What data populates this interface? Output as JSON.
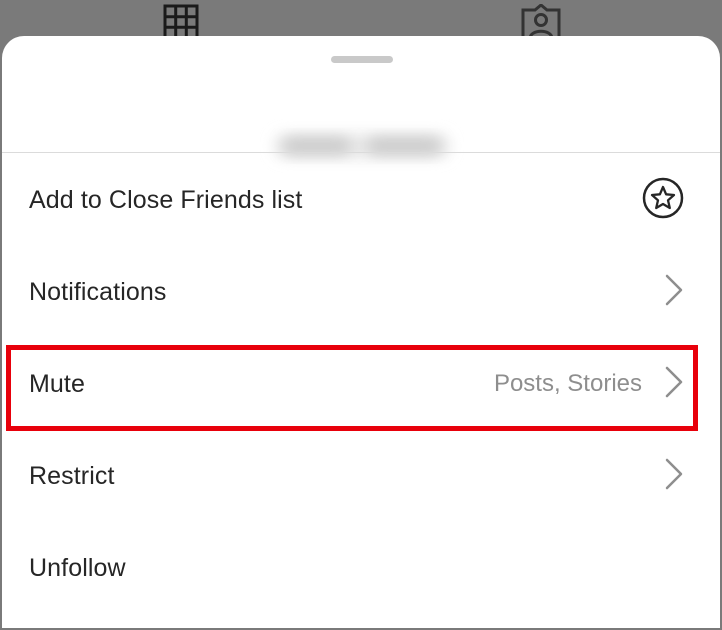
{
  "sheet": {
    "account_name_blurred": ""
  },
  "menu": {
    "items": [
      {
        "label": "Add to Close Friends list",
        "value": "",
        "icon": "star-circle-icon"
      },
      {
        "label": "Notifications",
        "value": "",
        "icon": "chevron-right-icon"
      },
      {
        "label": "Mute",
        "value": "Posts, Stories",
        "icon": "chevron-right-icon"
      },
      {
        "label": "Restrict",
        "value": "",
        "icon": "chevron-right-icon"
      },
      {
        "label": "Unfollow",
        "value": "",
        "icon": ""
      }
    ]
  },
  "background_tabs": {
    "icons": [
      "grid-icon",
      "tagged-person-icon"
    ]
  },
  "colors": {
    "overlay": "#7a7a7a",
    "sheet": "#ffffff",
    "text": "#262626",
    "secondary_text": "#8e8e8e",
    "highlight": "#e8000b"
  }
}
